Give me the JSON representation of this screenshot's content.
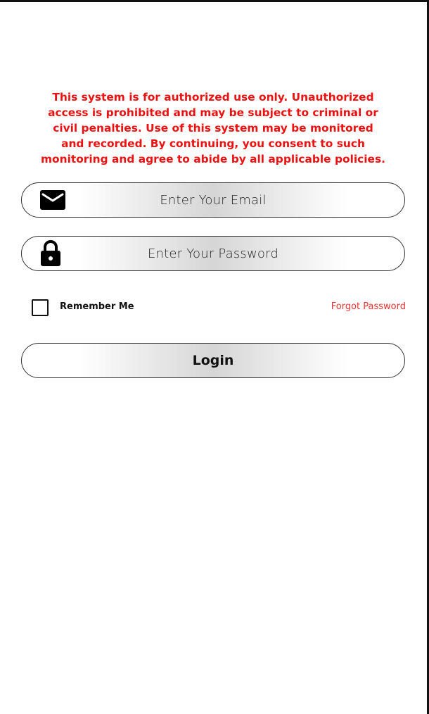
{
  "notice": {
    "text": "This system is for authorized use only. Unauthorized access is prohibited and may be subject to criminal or civil penalties. Use of this system may be monitored and recorded. By continuing, you consent to such monitoring and agree to abide by all applicable policies.",
    "color": "#ee1111"
  },
  "email": {
    "placeholder": "Enter Your Email",
    "icon": "mail-icon"
  },
  "password": {
    "placeholder": "Enter Your Password",
    "icon": "lock-icon"
  },
  "remember": {
    "label": "Remember Me",
    "checked": false
  },
  "forgot": {
    "label": "Forgot Password",
    "color": "#ee3333"
  },
  "login": {
    "label": "Login"
  }
}
